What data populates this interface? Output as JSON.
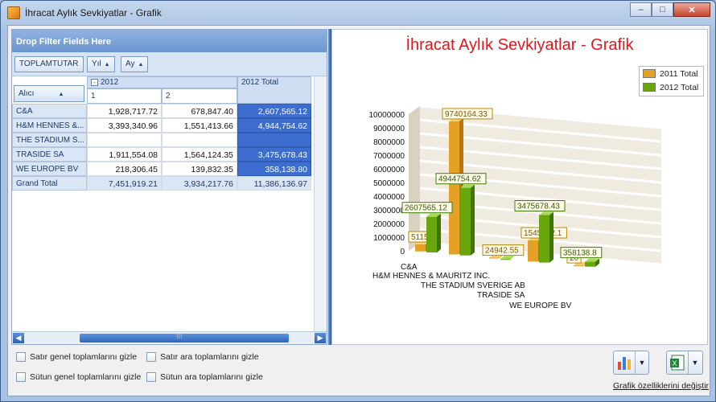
{
  "window": {
    "title": "İhracat Aylık Sevkiyatlar - Grafik",
    "minimize": "–",
    "maximize": "□",
    "close": "✕"
  },
  "pivot": {
    "filter_zone": "Drop Filter Fields Here",
    "data_field": "TOPLAMTUTAR",
    "column_fields": [
      {
        "label": "Yıl",
        "sort": "▲"
      },
      {
        "label": "Ay",
        "sort": "▲"
      }
    ],
    "row_field": {
      "label": "Alıcı",
      "sort": "▲"
    },
    "column_group": "2012",
    "collapse_icon": "minus-box-icon",
    "column_total_header": "2012 Total",
    "months": [
      "1",
      "2"
    ],
    "rows": [
      {
        "name": "C&A",
        "m1": "1,928,717.72",
        "m2": "678,847.40",
        "total": "2,607,565.12"
      },
      {
        "name": "H&M HENNES &...",
        "m1": "3,393,340.96",
        "m2": "1,551,413.66",
        "total": "4,944,754.62"
      },
      {
        "name": "THE STADIUM S...",
        "m1": "",
        "m2": "",
        "total": ""
      },
      {
        "name": "TRASIDE SA",
        "m1": "1,911,554.08",
        "m2": "1,564,124.35",
        "total": "3,475,678.43"
      },
      {
        "name": "WE EUROPE BV",
        "m1": "218,306.45",
        "m2": "139,832.35",
        "total": "358,138.80"
      },
      {
        "name": "Grand Total",
        "m1": "7,451,919.21",
        "m2": "3,934,217.76",
        "total": "11,386,136.97"
      }
    ],
    "scroll_left": "◀",
    "scroll_right": "▶",
    "scroll_grip": "⁞⁞⁞"
  },
  "chart_data": {
    "type": "bar",
    "title": "İhracat Aylık Sevkiyatlar - Grafik",
    "categories": [
      "C&A",
      "H&M HENNES & MAURITZ INC.",
      "THE STADIUM SVERIGE AB",
      "TRASIDE SA",
      "WE EUROPE BV"
    ],
    "series": [
      {
        "name": "2011 Total",
        "color": "#e5a126",
        "values": [
          511568,
          9740164.33,
          24942.55,
          1545972.1,
          20000
        ],
        "labels": [
          "511568",
          "9740164.33",
          "24942.55",
          "1545972.1",
          "20"
        ]
      },
      {
        "name": "2012 Total",
        "color": "#69a60d",
        "values": [
          2607565.12,
          4944754.62,
          0,
          3475678.43,
          358138.8
        ],
        "labels": [
          "2607565.12",
          "4944754.62",
          "",
          "3475678.43",
          "358138.8"
        ]
      }
    ],
    "y_ticks": [
      "0",
      "1000000",
      "2000000",
      "3000000",
      "4000000",
      "5000000",
      "6000000",
      "7000000",
      "8000000",
      "9000000",
      "10000000"
    ],
    "ylim": [
      0,
      10000000
    ],
    "legend_position": "top-right",
    "grid": true
  },
  "options": {
    "hide_row_grand_totals": "Satır genel toplamlarını gizle",
    "hide_row_subtotals": "Satır ara toplamlarını gizle",
    "hide_column_grand_totals": "Sütun genel toplamlarını gizle",
    "hide_column_subtotals": "Sütun ara toplamlarını gizle"
  },
  "toolbar": {
    "chart_type_icon": "bar-chart-icon",
    "export_icon": "excel-export-icon",
    "dropdown_glyph": "▼",
    "chart_settings_link": "Grafik özelliklerini değiştir"
  }
}
